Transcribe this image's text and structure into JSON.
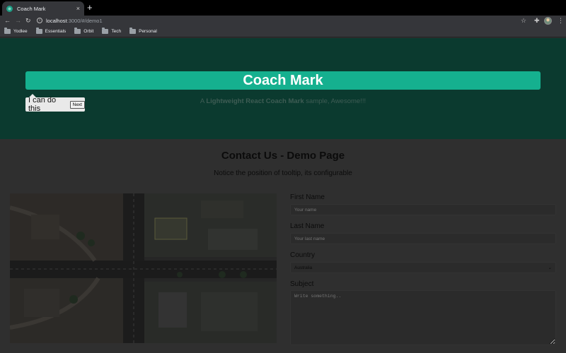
{
  "browser": {
    "tab_title": "Coach Mark",
    "tab_close": "×",
    "new_tab": "+",
    "url_host": "localhost",
    "url_path": ":3000/#/demo1",
    "bookmarks": [
      "Yodlee",
      "Essentials",
      "Orbit",
      "Tech",
      "Personal"
    ]
  },
  "hero": {
    "title": "Coach Mark",
    "subtitle_prefix": "A",
    "subtitle_bold": "Lightweight React Coach Mark",
    "subtitle_suffix": "sample, Awesome!!!"
  },
  "coach_tooltip": {
    "text": "I can do this",
    "next_label": "Next"
  },
  "contact": {
    "title": "Contact Us - Demo Page",
    "note": "Notice the position of tooltip, its configurable",
    "first_name_label": "First Name",
    "first_name_placeholder": "Your name",
    "last_name_label": "Last Name",
    "last_name_placeholder": "Your last name",
    "country_label": "Country",
    "country_value": "Australia",
    "subject_label": "Subject",
    "subject_placeholder": "Write something.."
  },
  "colors": {
    "hero_bg": "#0b3a2f",
    "accent": "#15b08f",
    "page_overlay": "#2f2f2f"
  }
}
